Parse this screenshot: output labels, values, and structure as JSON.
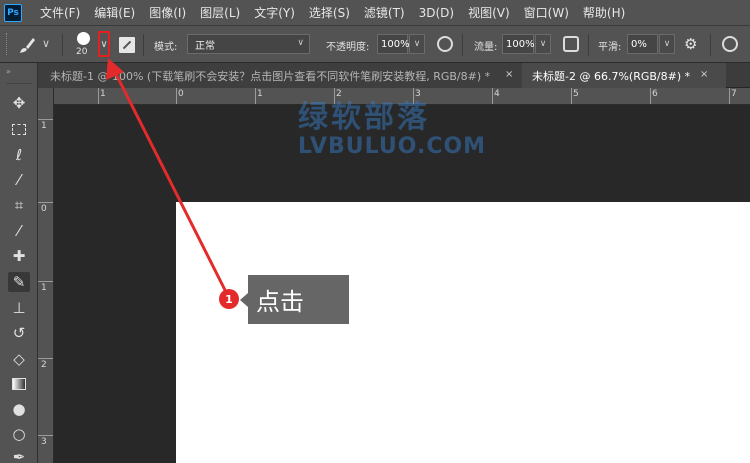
{
  "app": {
    "logo": "Ps"
  },
  "menu": [
    "文件(F)",
    "编辑(E)",
    "图像(I)",
    "图层(L)",
    "文字(Y)",
    "选择(S)",
    "滤镜(T)",
    "3D(D)",
    "视图(V)",
    "窗口(W)",
    "帮助(H)"
  ],
  "options": {
    "brush_size": "20",
    "mode_label": "模式:",
    "mode_value": "正常",
    "opacity_label": "不透明度:",
    "opacity_value": "100%",
    "flow_label": "流量:",
    "flow_value": "100%",
    "smoothing_label": "平滑:",
    "smoothing_value": "0%"
  },
  "tabs": [
    {
      "title": "未标题-1 @ 100% (下载笔刷不会安装？点击图片查看不同软件笔刷安装教程, RGB/8#) *",
      "close": "×"
    },
    {
      "title": "未标题-2 @ 66.7%(RGB/8#) *",
      "close": "×"
    }
  ],
  "ruler_h": [
    "1",
    "0",
    "1",
    "2",
    "3",
    "4",
    "5",
    "6",
    "7"
  ],
  "ruler_v": [
    "1",
    "0",
    "1",
    "2",
    "3"
  ],
  "watermark": {
    "cn": "绿软部落",
    "en": "LVBULUO.COM"
  },
  "annotation": {
    "badge": "1",
    "text": "点击",
    "color": "#e32b2b"
  },
  "colors": {
    "ui": "#535353",
    "workspace": "#282828",
    "highlight": "#e22020"
  }
}
